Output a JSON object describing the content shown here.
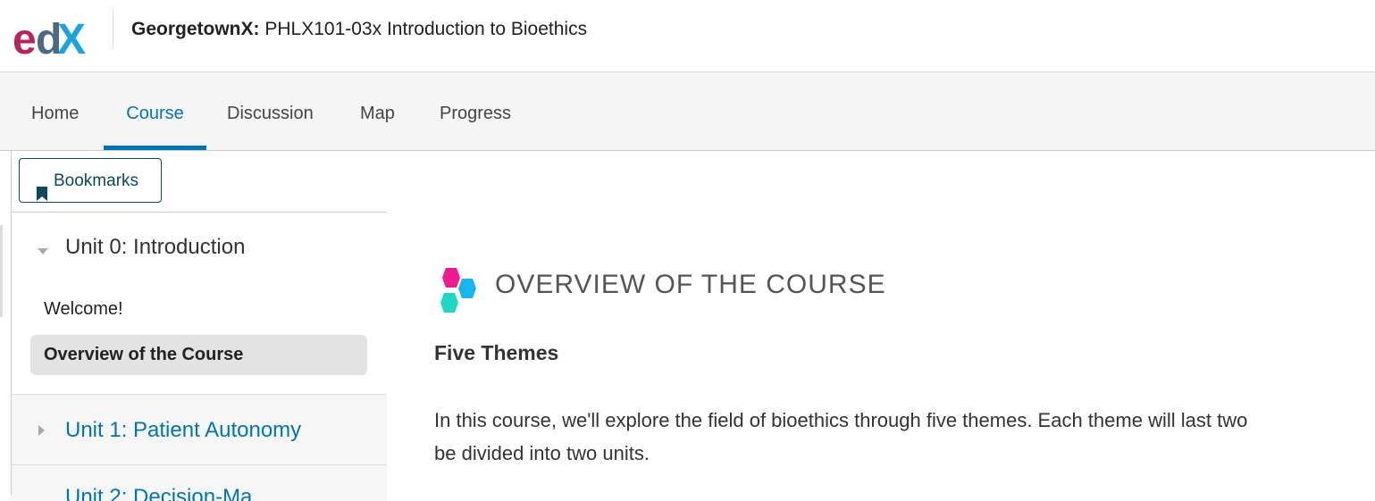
{
  "header": {
    "logo": "edX",
    "course_org": "GeorgetownX:",
    "course_name": "PHLX101-03x Introduction to Bioethics"
  },
  "nav": {
    "tabs": [
      {
        "label": "Home"
      },
      {
        "label": "Course",
        "active": true
      },
      {
        "label": "Discussion"
      },
      {
        "label": "Map"
      },
      {
        "label": "Progress"
      }
    ],
    "accent_color": "#0075b4"
  },
  "sidebar": {
    "bookmarks_label": "Bookmarks",
    "units": [
      {
        "title": "Unit 0: Introduction",
        "expanded": true,
        "items": [
          {
            "label": "Welcome!"
          },
          {
            "label": "Overview of the Course",
            "active": true
          }
        ]
      },
      {
        "title": "Unit 1: Patient Autonomy",
        "expanded": false
      },
      {
        "title": "Unit 2: Decision-Ma",
        "expanded": false
      }
    ]
  },
  "main": {
    "title": "OVERVIEW OF THE COURSE",
    "section_heading": "Five Themes",
    "paragraph_line1": "In this course, we'll explore the field of bioethics through five themes. Each theme will last two",
    "paragraph_line2": "be divided into two units."
  },
  "icons": {
    "bookmark": "bookmark-icon",
    "collapse": "caret-down-icon",
    "expand": "caret-right-icon",
    "hexagons": "hexagon-cluster-icon"
  }
}
